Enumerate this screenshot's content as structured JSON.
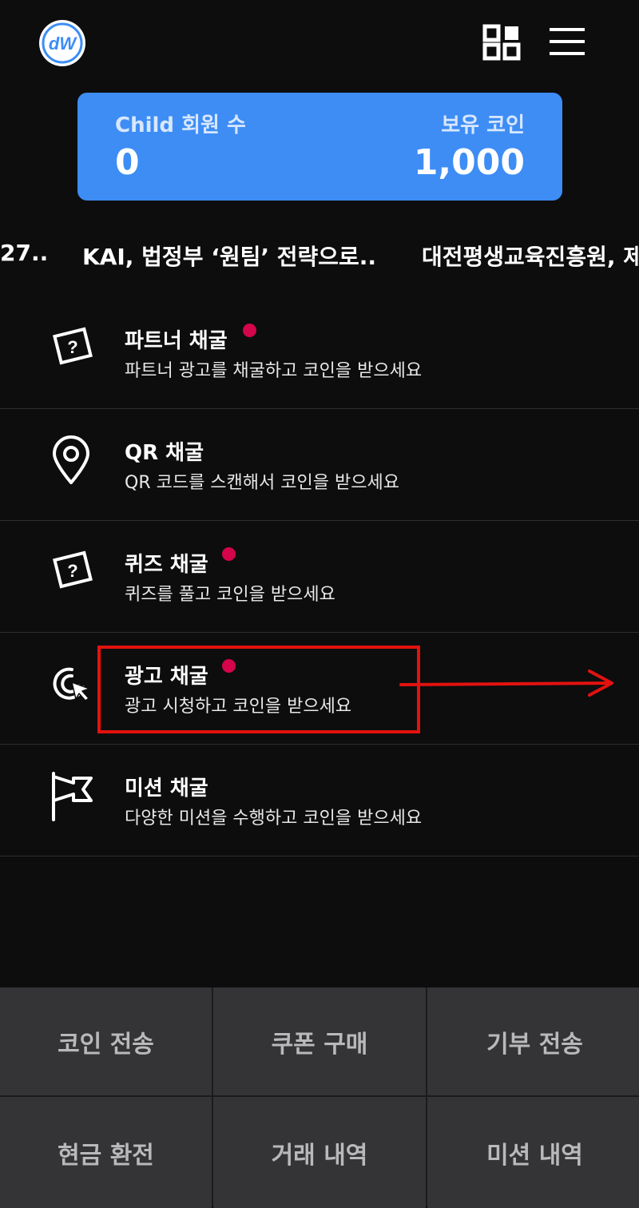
{
  "header": {
    "logo_text": "dW",
    "logo_icon": "dw-logo",
    "grid_icon": "grid-icon",
    "menu_icon": "hamburger-icon"
  },
  "stats": {
    "child_label": "Child 회원 수",
    "child_value": "0",
    "coin_label": "보유 코인",
    "coin_value": "1,000",
    "card_color": "#3d8df5"
  },
  "ticker": {
    "items": [
      "27..",
      "KAI, 법정부 ‘원팀’ 전략으로..",
      "대전평생교육진흥원, 제"
    ]
  },
  "mining": {
    "items": [
      {
        "title": "파트너 채굴",
        "desc": "파트너 광고를 채굴하고 코인을 받으세요",
        "icon": "question-box-icon",
        "has_dot": true
      },
      {
        "title": "QR 채굴",
        "desc": "QR 코드를 스캔해서 코인을 받으세요",
        "icon": "location-pin-icon",
        "has_dot": false
      },
      {
        "title": "퀴즈 채굴",
        "desc": "퀴즈를 풀고 코인을 받으세요",
        "icon": "question-box-icon",
        "has_dot": true
      },
      {
        "title": "광고 채굴",
        "desc": "광고 시청하고 코인을 받으세요",
        "icon": "click-cursor-icon",
        "has_dot": true
      },
      {
        "title": "미션 채굴",
        "desc": "다양한 미션을 수행하고 코인을 받으세요",
        "icon": "flag-icon",
        "has_dot": false
      }
    ],
    "dot_color": "#d4054a",
    "highlight_color": "#e3120f"
  },
  "bottom_buttons": {
    "coin_send": "코인 전송",
    "coupon_buy": "쿠폰 구매",
    "donation_send": "기부 전송",
    "cash_exchange": "현금 환전",
    "transaction_history": "거래 내역",
    "mission_history": "미션 내역"
  }
}
